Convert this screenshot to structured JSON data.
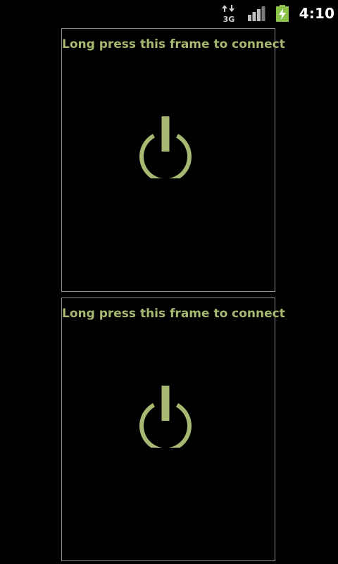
{
  "status_bar": {
    "network_icon": "data-3g-icon",
    "network_label": "3G",
    "signal_icon": "signal-strength-icon",
    "battery_icon": "battery-charging-icon",
    "time": "4:10"
  },
  "frames": [
    {
      "label": "Long press this frame to connect",
      "icon": "power-icon"
    },
    {
      "label": "Long press this frame to connect",
      "icon": "power-icon"
    }
  ],
  "colors": {
    "accent": "#a7b872",
    "background": "#000000",
    "frame_border": "#8f8f8f",
    "battery": "#8bc34a"
  }
}
